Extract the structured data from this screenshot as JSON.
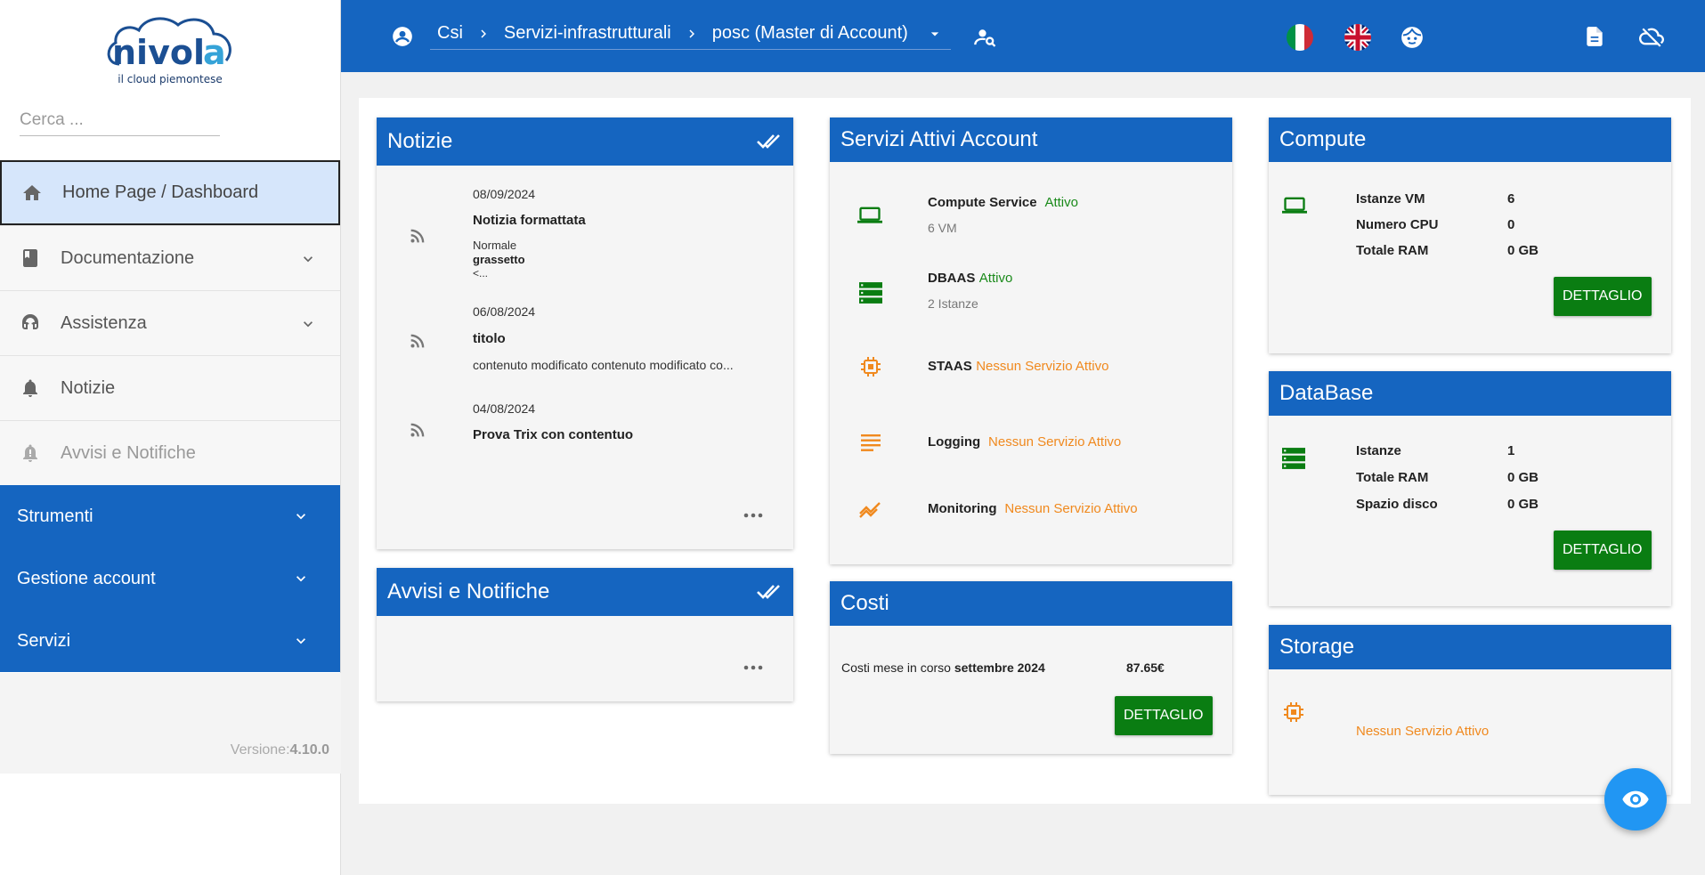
{
  "brand": {
    "tagline": "il cloud piemontese"
  },
  "sidebar": {
    "search_placeholder": "Cerca ...",
    "items": [
      {
        "label": "Home Page / Dashboard",
        "icon": "home-icon",
        "active": true
      },
      {
        "label": "Documentazione",
        "icon": "book-icon",
        "expandable": true
      },
      {
        "label": "Assistenza",
        "icon": "headset-icon",
        "expandable": true
      },
      {
        "label": "Notizie",
        "icon": "bell-icon"
      },
      {
        "label": "Avvisi e Notifiche",
        "icon": "bell-alert-icon",
        "disabled": true
      }
    ],
    "groups": [
      {
        "label": "Strumenti"
      },
      {
        "label": "Gestione account"
      },
      {
        "label": "Servizi"
      }
    ],
    "version_label": "Versione:",
    "version_value": "4.10.0"
  },
  "topbar": {
    "breadcrumb": [
      "Csi",
      "Servizi-infrastrutturali",
      "posc (Master di Account)"
    ]
  },
  "news": {
    "title": "Notizie",
    "items": [
      {
        "date": "08/09/2024",
        "title": "Notizia formattata",
        "body_line1": "Normale",
        "body_line2": "grassetto",
        "body_line3": "<..."
      },
      {
        "date": "06/08/2024",
        "title": "titolo",
        "body_line1": "contenuto modificato contenuto modificato co..."
      },
      {
        "date": "04/08/2024",
        "title": "Prova Trix con contentuo"
      }
    ]
  },
  "alerts": {
    "title": "Avvisi e Notifiche"
  },
  "services": {
    "title": "Servizi Attivi Account",
    "items": [
      {
        "name": "Compute Service",
        "status": "Attivo",
        "detail": "6 VM",
        "state": "active"
      },
      {
        "name": "DBAAS",
        "status": "Attivo",
        "detail": "2 Istanze",
        "state": "active"
      },
      {
        "name": "STAAS",
        "status": "Nessun Servizio Attivo",
        "state": "inactive"
      },
      {
        "name": "Logging",
        "status": "Nessun Servizio Attivo",
        "state": "inactive"
      },
      {
        "name": "Monitoring",
        "status": "Nessun Servizio Attivo",
        "state": "inactive"
      }
    ]
  },
  "costs": {
    "title": "Costi",
    "label": "Costi mese in corso",
    "month": "settembre 2024",
    "amount": "87.65€",
    "button": "DETTAGLIO"
  },
  "compute": {
    "title": "Compute",
    "rows": [
      {
        "label": "Istanze VM",
        "value": "6"
      },
      {
        "label": "Numero CPU",
        "value": "0"
      },
      {
        "label": "Totale RAM",
        "value": "0 GB"
      }
    ],
    "button": "DETTAGLIO"
  },
  "database": {
    "title": "DataBase",
    "rows": [
      {
        "label": "Istanze",
        "value": "1"
      },
      {
        "label": "Totale RAM",
        "value": "0 GB"
      },
      {
        "label": "Spazio disco",
        "value": "0 GB"
      }
    ],
    "button": "DETTAGLIO"
  },
  "storage": {
    "title": "Storage",
    "status": "Nessun Servizio Attivo"
  },
  "colors": {
    "primary": "#1565c0",
    "success": "#0a7d12",
    "active_text": "#1a8a1a",
    "inactive_text": "#f0891e",
    "fab": "#2196f3"
  }
}
